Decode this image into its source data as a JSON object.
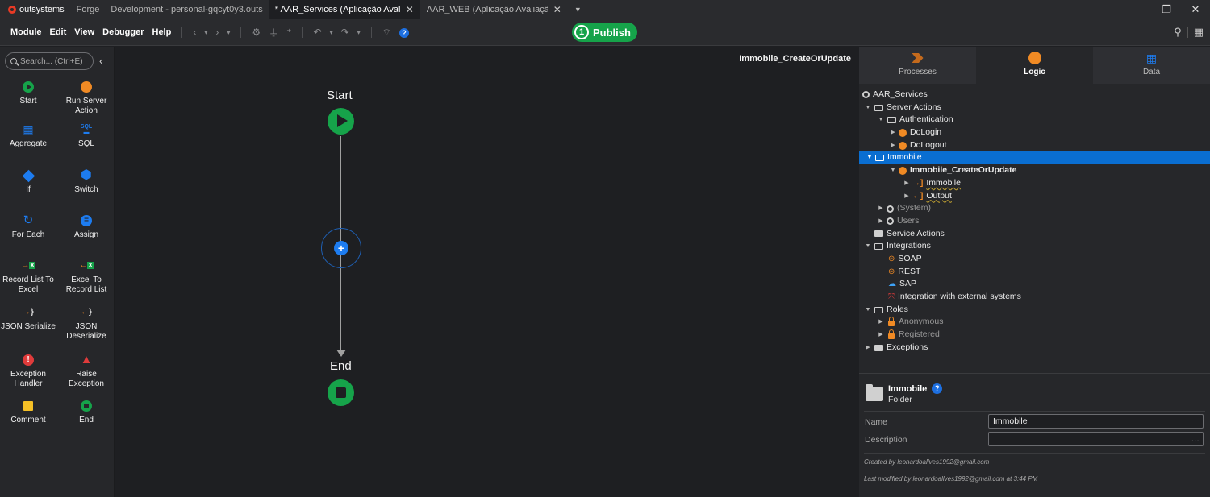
{
  "titlebar": {
    "brand": "outsystems",
    "links": [
      "Forge",
      "Development - personal-gqcyt0y3.outs"
    ],
    "tabs": [
      {
        "label": "* AAR_Services (Aplicação Avaliação",
        "active": true
      },
      {
        "label": "AAR_WEB (Aplicação Avaliação Imo",
        "active": false
      }
    ]
  },
  "menubar": {
    "items": [
      "Module",
      "Edit",
      "View",
      "Debugger",
      "Help"
    ],
    "publish_count": "1",
    "publish_label": "Publish"
  },
  "toolbox": {
    "search_placeholder": "Search... (Ctrl+E)",
    "tools": [
      {
        "label": "Start",
        "icon": "start-icon",
        "color": "#16a34a"
      },
      {
        "label": "Run Server Action",
        "icon": "run-server-action-icon",
        "color": "#f08a24"
      },
      {
        "label": "Aggregate",
        "icon": "aggregate-icon",
        "color": "#1d7cf0"
      },
      {
        "label": "SQL",
        "icon": "sql-icon",
        "color": "#1d7cf0"
      },
      {
        "label": "If",
        "icon": "if-icon",
        "color": "#1d7cf0"
      },
      {
        "label": "Switch",
        "icon": "switch-icon",
        "color": "#1d7cf0"
      },
      {
        "label": "For Each",
        "icon": "for-each-icon",
        "color": "#1d7cf0"
      },
      {
        "label": "Assign",
        "icon": "assign-icon",
        "color": "#1d7cf0"
      },
      {
        "label": "Record List To Excel",
        "icon": "record-list-to-excel-icon",
        "color": "#16a34a"
      },
      {
        "label": "Excel To Record List",
        "icon": "excel-to-record-list-icon",
        "color": "#16a34a"
      },
      {
        "label": "JSON Serialize",
        "icon": "json-serialize-icon",
        "color": "#f08a24"
      },
      {
        "label": "JSON Deserialize",
        "icon": "json-deserialize-icon",
        "color": "#f08a24"
      },
      {
        "label": "Exception Handler",
        "icon": "exception-handler-icon",
        "color": "#e03b3b"
      },
      {
        "label": "Raise Exception",
        "icon": "raise-exception-icon",
        "color": "#e03b3b"
      },
      {
        "label": "Comment",
        "icon": "comment-icon",
        "color": "#f5c026"
      },
      {
        "label": "End",
        "icon": "end-icon",
        "color": "#16a34a"
      }
    ]
  },
  "canvas": {
    "title": "Immobile_CreateOrUpdate",
    "start_label": "Start",
    "end_label": "End"
  },
  "right_tabs": [
    {
      "label": "Processes",
      "active": false
    },
    {
      "label": "Logic",
      "active": true
    },
    {
      "label": "Data",
      "active": false
    }
  ],
  "tree": [
    {
      "label": "AAR_Services"
    },
    {
      "label": "Server Actions"
    },
    {
      "label": "Authentication"
    },
    {
      "label": "DoLogin"
    },
    {
      "label": "DoLogout"
    },
    {
      "label": "Immobile"
    },
    {
      "label": "Immobile_CreateOrUpdate"
    },
    {
      "label": "Immobile"
    },
    {
      "label": "Output"
    },
    {
      "label": "(System)"
    },
    {
      "label": "Users"
    },
    {
      "label": "Service Actions"
    },
    {
      "label": "Integrations"
    },
    {
      "label": "SOAP"
    },
    {
      "label": "REST"
    },
    {
      "label": "SAP"
    },
    {
      "label": "Integration with external systems"
    },
    {
      "label": "Roles"
    },
    {
      "label": "Anonymous"
    },
    {
      "label": "Registered"
    },
    {
      "label": "Exceptions"
    }
  ],
  "properties": {
    "name": "Immobile",
    "type": "Folder",
    "name_label": "Name",
    "name_value": "Immobile",
    "description_label": "Description",
    "description_value": "",
    "created_by": "Created by leonardoallves1992@gmail.com",
    "modified_by": "Last modified by leonardoallves1992@gmail.com at 3:44 PM"
  }
}
